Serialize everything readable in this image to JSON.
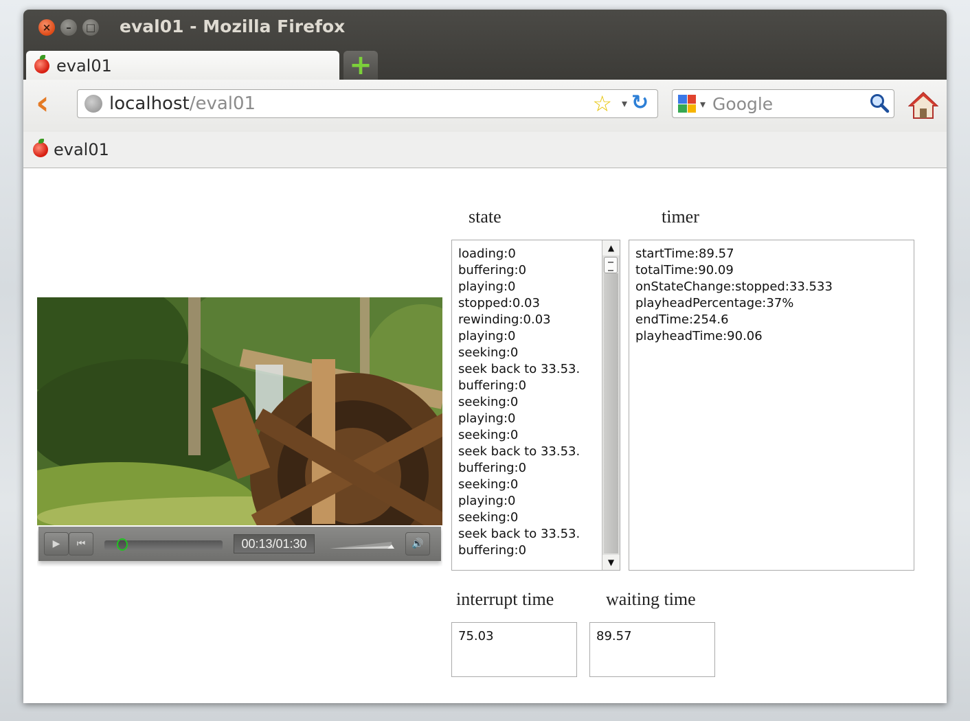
{
  "window": {
    "title": "eval01 - Mozilla Firefox",
    "buttons": {
      "close": "×",
      "minimize": "–",
      "maximize": "□"
    }
  },
  "tabs": [
    {
      "label": "eval01"
    }
  ],
  "new_tab_glyph": "+",
  "navbar": {
    "back_glyph": "‹",
    "url_host": "localhost",
    "url_path": "/eval01",
    "star_glyph": "☆",
    "dropdown_glyph": "▾",
    "reload_glyph": "↻",
    "search_placeholder": "Google"
  },
  "bookmarks": [
    {
      "label": "eval01"
    }
  ],
  "page": {
    "state": {
      "heading": "state",
      "lines": [
        "loading:0",
        "buffering:0",
        "playing:0",
        "stopped:0.03",
        "rewinding:0.03",
        "playing:0",
        "seeking:0",
        "seek back to 33.53.",
        "buffering:0",
        "seeking:0",
        "playing:0",
        "seeking:0",
        "seek back to 33.53.",
        "buffering:0",
        "seeking:0",
        "playing:0",
        "seeking:0",
        "seek back to 33.53.",
        "buffering:0"
      ]
    },
    "timer": {
      "heading": "timer",
      "lines": [
        "startTime:89.57",
        "totalTime:90.09",
        "onStateChange:stopped:33.533",
        "playheadPercentage:37%",
        "endTime:254.6",
        "playheadTime:90.06"
      ]
    },
    "interrupt": {
      "heading": "interrupt time",
      "value": "75.03"
    },
    "waiting": {
      "heading": "waiting time",
      "value": "89.57"
    },
    "video": {
      "time_display": "00:13/01:30",
      "progress_fraction": 0.1,
      "play_glyph": "▶",
      "rewind_glyph": "⏮",
      "volume_glyph": "🔊"
    }
  },
  "colors": {
    "titlebar": "#3c3b37",
    "close_button": "#df4a16",
    "accent_orange": "#e47a25",
    "progress_knob": "#22c222"
  }
}
